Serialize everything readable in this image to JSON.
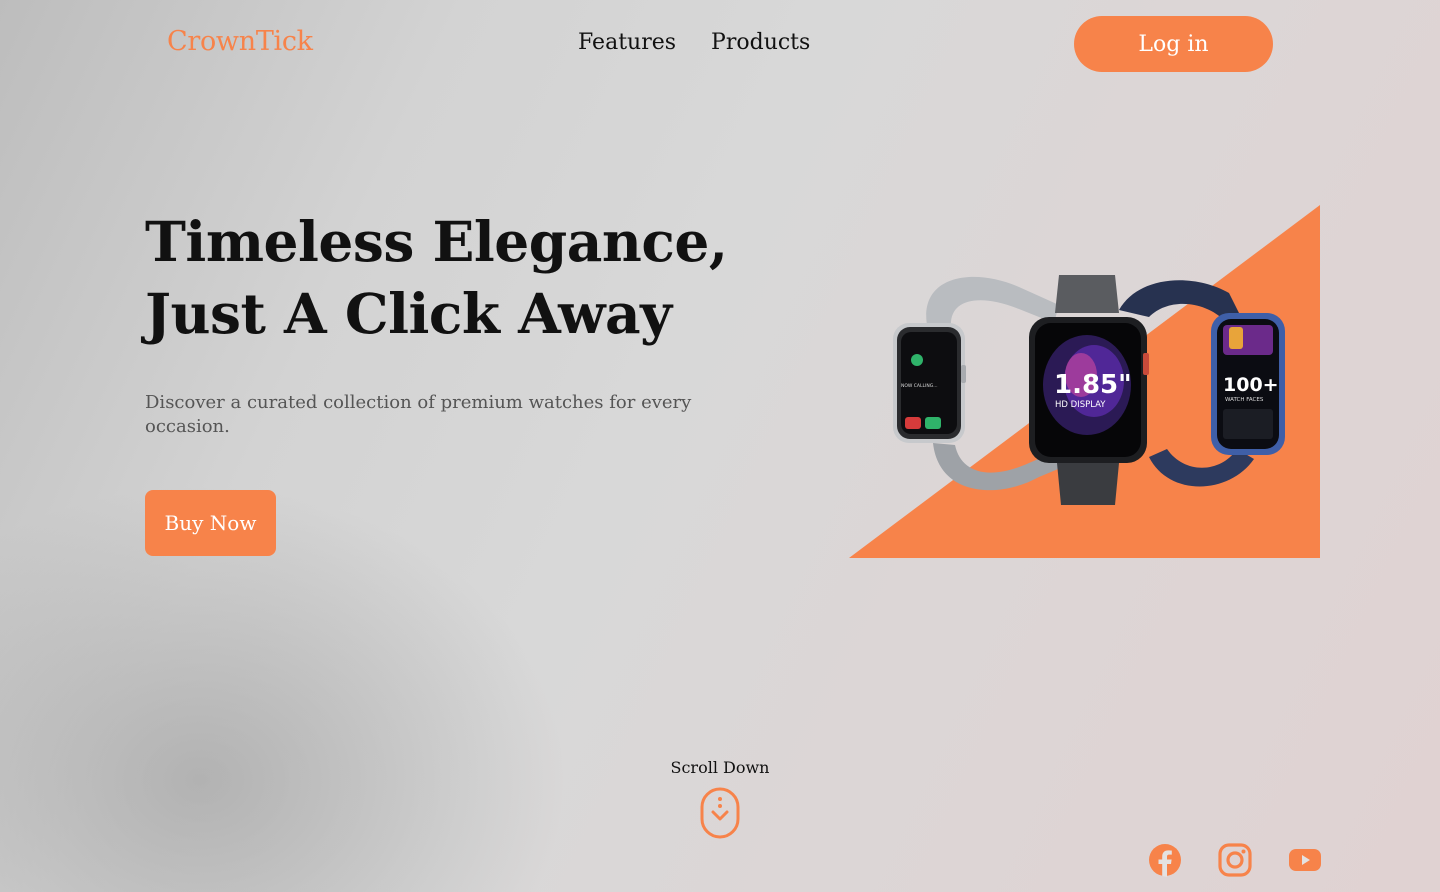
{
  "brand": {
    "name": "CrownTick",
    "accent": "#f7834a"
  },
  "nav": {
    "items": [
      {
        "label": "Features"
      },
      {
        "label": "Products"
      }
    ]
  },
  "header": {
    "login_label": "Log in"
  },
  "hero": {
    "title_line1": "Timeless Elegance,",
    "title_line2": "Just A Click Away",
    "subtitle": "Discover a curated collection of premium watches for every occasion.",
    "cta_label": "Buy Now",
    "watch_center_size": "1.85\"",
    "watch_center_caption": "HD DISPLAY",
    "watch_right_count": "100+",
    "watch_right_caption": "WATCH FACES",
    "watch_left_caption": "NOW CALLING..."
  },
  "scroll": {
    "label": "Scroll Down"
  },
  "socials": [
    {
      "icon": "facebook-icon"
    },
    {
      "icon": "instagram-icon"
    },
    {
      "icon": "youtube-icon"
    }
  ]
}
